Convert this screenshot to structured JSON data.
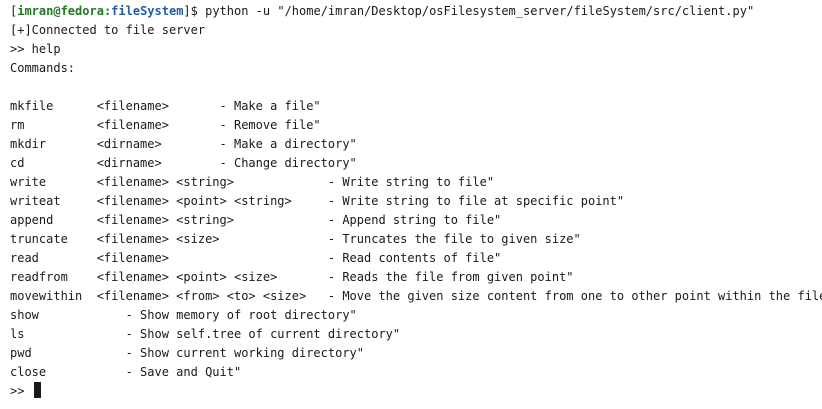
{
  "prompt": {
    "open_bracket": "[",
    "user_host": "imran@fedora",
    "colon": ":",
    "directory": "fileSystem",
    "close_bracket": "]$ ",
    "command": "python -u \"/home/imran/Desktop/osFilesystem_server/fileSystem/src/client.py\""
  },
  "output_lines": [
    "[+]Connected to file server",
    ">> help",
    "Commands:",
    "",
    "mkfile      <filename>       - Make a file\"",
    "rm          <filename>       - Remove file\"",
    "mkdir       <dirname>        - Make a directory\"",
    "cd          <dirname>        - Change directory\"",
    "write       <filename> <string>             - Write string to file\"",
    "writeat     <filename> <point> <string>     - Write string to file at specific point\"",
    "append      <filename> <string>             - Append string to file\"",
    "truncate    <filename> <size>               - Truncates the file to given size\"",
    "read        <filename>                      - Read contents of file\"",
    "readfrom    <filename> <point> <size>       - Reads the file from given point\"",
    "movewithin  <filename> <from> <to> <size>   - Move the given size content from one to other point within the file\"",
    "show            - Show memory of root directory\"",
    "ls              - Show self.tree of current directory\"",
    "pwd             - Show current working directory\"",
    "close           - Save and Quit\""
  ],
  "input_prompt": ">> "
}
